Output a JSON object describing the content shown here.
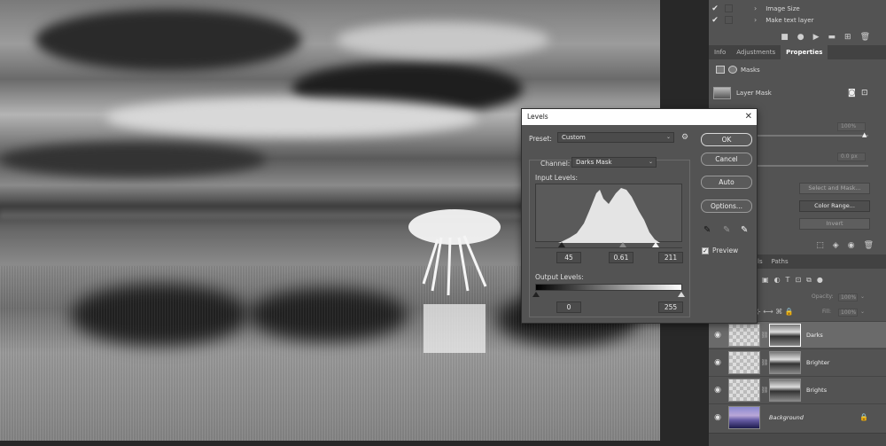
{
  "history": {
    "items": [
      {
        "label": "Image Size"
      },
      {
        "label": "Make text layer"
      }
    ]
  },
  "properties": {
    "tabs": [
      "Info",
      "Adjustments",
      "Properties"
    ],
    "active_tab": "Properties",
    "masks_label": "Masks",
    "layer_mask_label": "Layer Mask",
    "density_value": "100%",
    "feather_value": "0.0 px",
    "select_mask_button": "Select and Mask...",
    "color_range_button": "Color Range...",
    "invert_button": "Invert"
  },
  "layers_panel": {
    "tabs": [
      "ls",
      "Paths"
    ],
    "opacity_label": "Opacity:",
    "opacity_value": "100%",
    "fill_label": "Fill:",
    "fill_value": "100%",
    "layers": [
      {
        "name": "Darks",
        "selected": true
      },
      {
        "name": "Brighter",
        "selected": false
      },
      {
        "name": "Brights",
        "selected": false
      },
      {
        "name": "Background",
        "selected": false,
        "locked": true
      }
    ]
  },
  "levels_dialog": {
    "title": "Levels",
    "preset_label": "Preset:",
    "preset_value": "Custom",
    "channel_label": "Channel:",
    "channel_value": "Darks Mask",
    "input_levels_label": "Input Levels:",
    "input_black": "45",
    "input_gamma": "0.61",
    "input_white": "211",
    "output_levels_label": "Output Levels:",
    "output_black": "0",
    "output_white": "255",
    "buttons": {
      "ok": "OK",
      "cancel": "Cancel",
      "auto": "Auto",
      "options": "Options..."
    },
    "preview_label": "Preview",
    "preview_checked": true
  },
  "colors": {
    "panel_bg": "#535353",
    "dialog_titlebar": "#fefefe",
    "selected_layer": "#6a6a6a"
  }
}
